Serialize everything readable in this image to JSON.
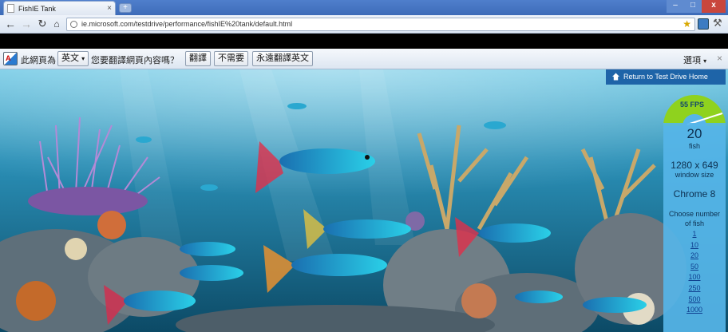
{
  "browser": {
    "tab_title": "FishIE Tank",
    "new_tab": "+",
    "url": "ie.microsoft.com/testdrive/performance/fishIE%20tank/default.html",
    "window_controls": {
      "minimize": "–",
      "maximize": "□",
      "close": "x"
    }
  },
  "translate_bar": {
    "prefix": "此網頁為",
    "language": "英文",
    "question": "您要翻譯網頁內容嗎？",
    "translate_btn": "翻譯",
    "no_btn": "不需要",
    "always_btn": "永遠翻譯英文",
    "options": "選項",
    "close": "×"
  },
  "page": {
    "return_link": "Return to Test Drive Home",
    "fps": "55 FPS",
    "fish_count": "20",
    "fish_label": "fish",
    "window_size": "1280 x 649",
    "window_size_label": "window size",
    "browser_name": "Chrome 8",
    "choose_label": "Choose number of fish",
    "fish_options": [
      "1",
      "10",
      "20",
      "50",
      "100",
      "250",
      "500",
      "1000"
    ]
  },
  "colors": {
    "water_top": "#5ab8d8",
    "water_bottom": "#0f4f6e",
    "return_bg": "#1e64a8",
    "panel_bg": "#56b5e8",
    "gauge_green": "#8fd21e"
  }
}
